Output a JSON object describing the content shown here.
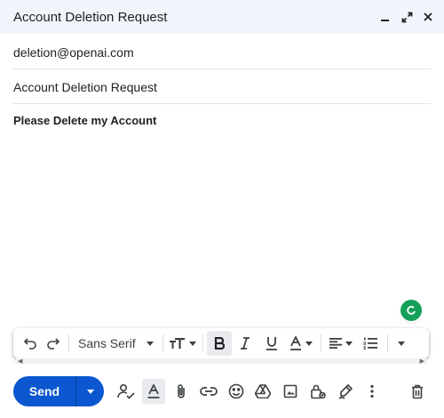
{
  "window": {
    "title": "Account Deletion Request",
    "controls": [
      "minimize-icon",
      "expand-icon",
      "close-icon"
    ]
  },
  "compose": {
    "to": "deletion@openai.com",
    "subject": "Account Deletion Request",
    "body": "Please Delete my Account"
  },
  "format_toolbar": {
    "font_name": "Sans Serif",
    "items": [
      "undo-icon",
      "redo-icon",
      "font-select",
      "text-size-icon",
      "bold-icon",
      "italic-icon",
      "underline-icon",
      "text-color-icon",
      "align-icon",
      "numbered-list-icon",
      "more-formatting-icon"
    ]
  },
  "bottom_bar": {
    "send_label": "Send",
    "icons": [
      "recipients-check-icon",
      "formatting-options-icon",
      "attach-icon",
      "link-icon",
      "emoji-icon",
      "drive-icon",
      "photo-icon",
      "confidential-icon",
      "signature-icon",
      "more-options-icon",
      "delete-icon"
    ]
  },
  "colors": {
    "title_bg": "#f2f6fc",
    "send_blue": "#0b57d0",
    "grammarly_green": "#15a05a"
  }
}
